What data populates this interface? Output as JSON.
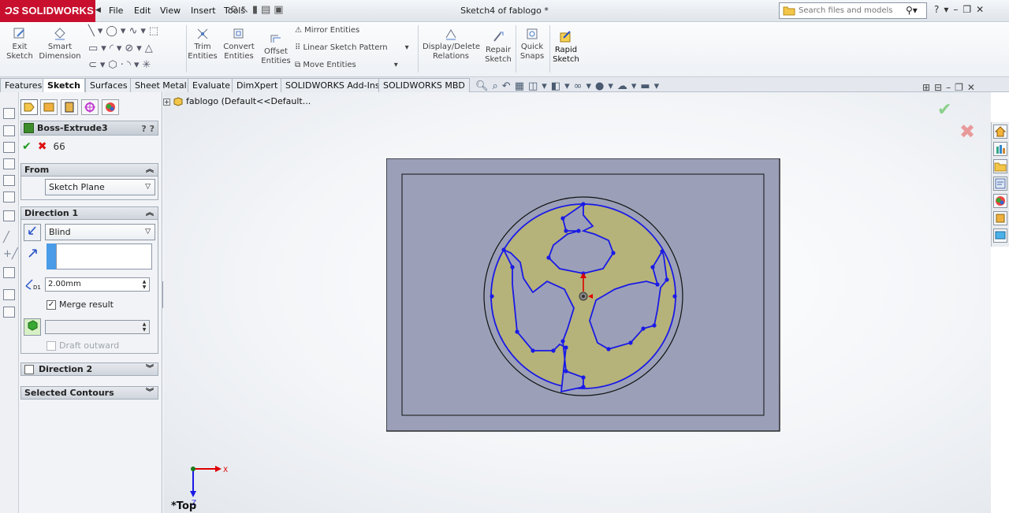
{
  "app": {
    "brand": "SOLIDWORKS",
    "document_title": "Sketch4 of fablogo *"
  },
  "menus": [
    "File",
    "Edit",
    "View",
    "Insert",
    "Tools"
  ],
  "search": {
    "placeholder": "Search files and models"
  },
  "command_manager": {
    "exit_sketch": [
      "Exit",
      "Sketch"
    ],
    "smart_dimension": [
      "Smart",
      "Dimension"
    ],
    "trim_entities": [
      "Trim",
      "Entities"
    ],
    "convert_entities": [
      "Convert",
      "Entities"
    ],
    "offset_entities": [
      "Offset",
      "Entities"
    ],
    "mirror_entities": "Mirror Entities",
    "linear_sketch_pattern": "Linear Sketch Pattern",
    "move_entities": "Move Entities",
    "display_delete_relations": [
      "Display/Delete",
      "Relations"
    ],
    "repair_sketch": [
      "Repair",
      "Sketch"
    ],
    "quick_snaps": [
      "Quick",
      "Snaps"
    ],
    "rapid_sketch": [
      "Rapid",
      "Sketch"
    ]
  },
  "tabs": [
    {
      "label": "Features",
      "active": false
    },
    {
      "label": "Sketch",
      "active": true
    },
    {
      "label": "Surfaces",
      "active": false
    },
    {
      "label": "Sheet Metal",
      "active": false
    },
    {
      "label": "Evaluate",
      "active": false
    },
    {
      "label": "DimXpert",
      "active": false
    },
    {
      "label": "SOLIDWORKS Add-Ins",
      "active": false
    },
    {
      "label": "SOLIDWORKS MBD",
      "active": false
    }
  ],
  "property_manager": {
    "title": "Boss-Extrude3",
    "help": "? ?",
    "from": {
      "header": "From",
      "value": "Sketch Plane"
    },
    "direction1": {
      "header": "Direction 1",
      "end_condition": "Blind",
      "depth": "2.00mm",
      "merge_result_label": "Merge result",
      "merge_result_checked": true,
      "draft_outward_label": "Draft outward",
      "draft_outward_checked": false
    },
    "direction2": {
      "header": "Direction 2",
      "checked": false
    },
    "selected_contours": {
      "header": "Selected Contours"
    }
  },
  "feature_tree": {
    "root_label": "fablogo  (Default<<Default..."
  },
  "view": {
    "orientation_label": "*Top",
    "triad_x": "X",
    "triad_z": "Z"
  },
  "colors": {
    "brand_red": "#c8102e",
    "plate_fill": "#9ba0b8",
    "sketch_blue": "#1a1ae6",
    "logo_fill": "#b5b27a"
  }
}
